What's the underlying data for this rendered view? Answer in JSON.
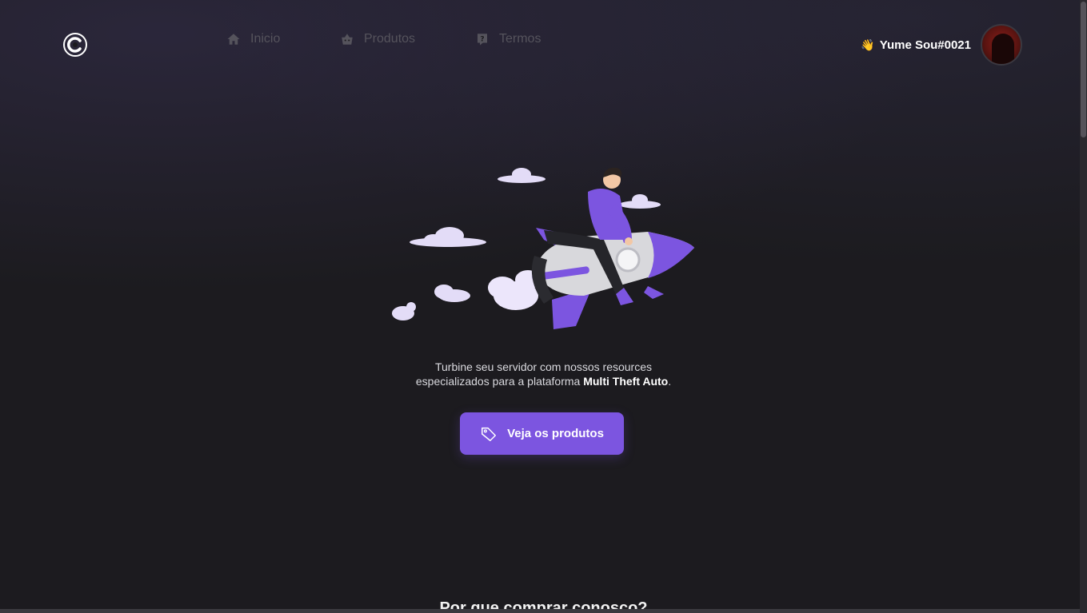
{
  "nav": {
    "items": [
      {
        "label": "Inicio",
        "icon": "home-icon"
      },
      {
        "label": "Produtos",
        "icon": "basket-icon"
      },
      {
        "label": "Termos",
        "icon": "question-icon"
      }
    ]
  },
  "user": {
    "greeting_emoji": "👋",
    "name": "Yume Sou#0021"
  },
  "hero": {
    "line1": "Turbine seu servidor com nossos resources",
    "line2_prefix": "especializados para a plataforma ",
    "line2_bold": "Multi Theft Auto",
    "line2_suffix": "."
  },
  "cta": {
    "label": "Veja os produtos",
    "icon": "tag-icon"
  },
  "section": {
    "title": "Por que comprar conosco?"
  },
  "colors": {
    "background": "#1c1b1f",
    "accent": "#7c55e0",
    "nav_text": "#55535c"
  }
}
